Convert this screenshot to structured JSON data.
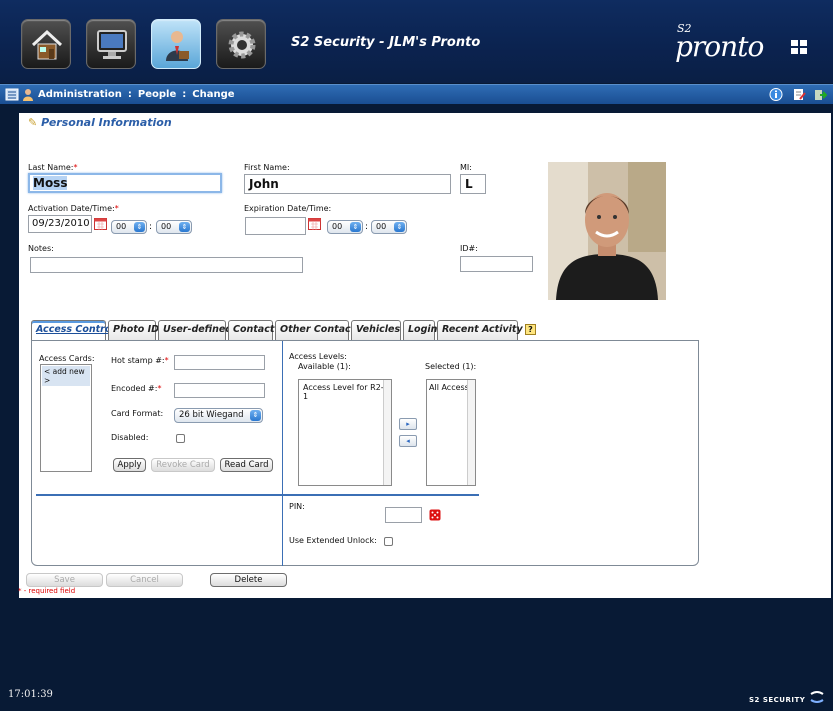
{
  "header": {
    "app_title": "S2 Security - JLM's Pronto",
    "logo_s2": "S2",
    "logo_word": "pronto"
  },
  "nav": [
    {
      "icon": "home-icon"
    },
    {
      "icon": "monitor-icon"
    },
    {
      "icon": "people-icon",
      "active": true
    },
    {
      "icon": "gear-icon"
    }
  ],
  "breadcrumb": {
    "section": "Administration",
    "page": "People",
    "action": "Change",
    "sep": ":"
  },
  "section_title": "Personal Information",
  "form": {
    "last_name_label": "Last Name:",
    "last_name": "Moss",
    "first_name_label": "First Name:",
    "first_name": "John",
    "mi_label": "MI:",
    "mi": "L",
    "activation_label": "Activation Date/Time:",
    "activation_date": "09/23/2010",
    "activation_hour": "00",
    "activation_min": "00",
    "expiration_label": "Expiration Date/Time:",
    "expiration_date": "",
    "expiration_hour": "00",
    "expiration_min": "00",
    "time_sep": ":",
    "notes_label": "Notes:",
    "notes": "",
    "id_label": "ID#:",
    "id": "",
    "required_mark": "*"
  },
  "tabs": [
    "Access Control",
    "Photo ID",
    "User-defined",
    "Contact",
    "Other Contact",
    "Vehicles",
    "Login",
    "Recent Activity"
  ],
  "tab_help": "?",
  "access": {
    "cards_label": "Access Cards:",
    "cards": [
      "< add new >"
    ],
    "hotstamp_label": "Hot stamp #:",
    "encoded_label": "Encoded #:",
    "card_format_label": "Card Format:",
    "card_format": "26 bit Wiegand",
    "disabled_label": "Disabled:",
    "apply": "Apply",
    "revoke": "Revoke Card",
    "read": "Read Card",
    "levels_label": "Access Levels:",
    "available_label": "Available (1):",
    "selected_label": "Selected (1):",
    "available": [
      "Access Level for R2-1"
    ],
    "selected": [
      "All Access"
    ],
    "move_right": "▸",
    "move_left": "◂",
    "pin_label": "PIN:",
    "extended_unlock_label": "Use Extended Unlock:"
  },
  "actions": {
    "save": "Save",
    "cancel": "Cancel",
    "delete": "Delete",
    "required_note": "* - required field"
  },
  "footer": {
    "time": "17:01:39",
    "brand": "S2 SECURITY"
  },
  "colors": {
    "page_bg": "#081a35",
    "crumb_bar": "#2a64aa",
    "accent": "#1c4f9a",
    "required": "#dd0000"
  }
}
